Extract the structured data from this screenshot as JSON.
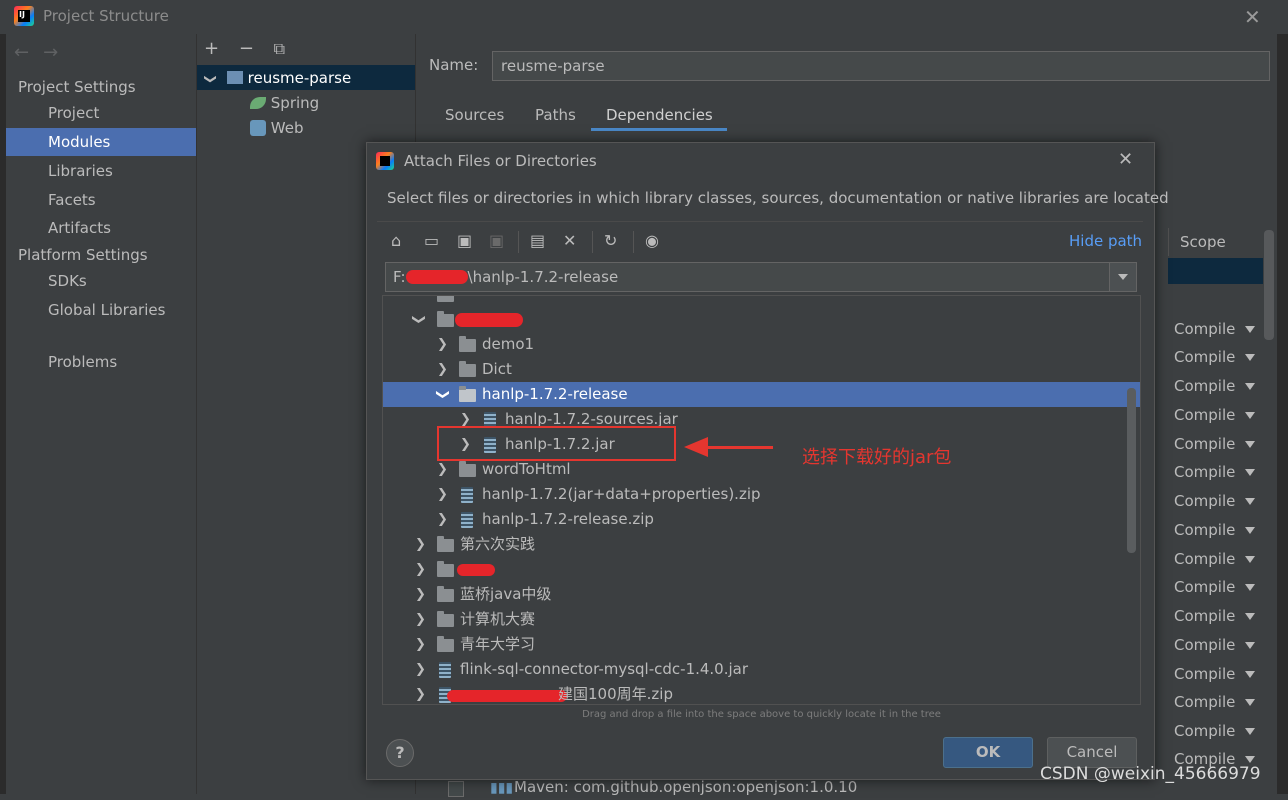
{
  "window": {
    "title": "Project Structure",
    "close": "✕"
  },
  "nav": {
    "back": "←",
    "forward": "→"
  },
  "sidebar": {
    "project_settings": "Project Settings",
    "items_ps": [
      "Project",
      "Modules",
      "Libraries",
      "Facets",
      "Artifacts"
    ],
    "platform_settings": "Platform Settings",
    "items_plat": [
      "SDKs",
      "Global Libraries"
    ],
    "problems": "Problems",
    "selected": "Modules"
  },
  "module_toolbar": {
    "add": "+",
    "remove": "−",
    "copy": "⧉"
  },
  "module_tree": {
    "root": "reusme-parse",
    "children": [
      "Spring",
      "Web"
    ]
  },
  "module_panel": {
    "name_label": "Name:",
    "name_value": "reusme-parse",
    "tabs": [
      "Sources",
      "Paths",
      "Dependencies"
    ],
    "active_tab": "Dependencies",
    "scope_header": "Scope",
    "scope_value": "Compile",
    "maven_row": "Maven: com.github.openjson:openjson:1.0.10"
  },
  "dialog": {
    "title": "Attach Files or Directories",
    "close": "✕",
    "description": "Select files or directories in which library classes, sources, documentation or native libraries are located",
    "hide_path": "Hide path",
    "path_prefix": "F:",
    "path_suffix": "\\hanlp-1.7.2-release",
    "tree": {
      "demo1": "demo1",
      "dict": "Dict",
      "release": "hanlp-1.7.2-release",
      "sources_jar": "hanlp-1.7.2-sources.jar",
      "main_jar": "hanlp-1.7.2.jar",
      "word_to_html": "wordToHtml",
      "zip_props": "hanlp-1.7.2(jar+data+properties).zip",
      "zip_release": "hanlp-1.7.2-release.zip",
      "practice6": "第六次实践",
      "lanqiao": "蓝桥java中级",
      "computer": "计算机大赛",
      "youth": "青年大学习",
      "flink_jar": "flink-sql-connector-mysql-cdc-1.4.0.jar",
      "zip_100": "建国100周年.zip"
    },
    "hint": "Drag and drop a file into the space above to quickly locate it in the tree",
    "help": "?",
    "ok": "OK",
    "cancel": "Cancel"
  },
  "annotation": {
    "text": "选择下载好的jar包",
    "color": "#e5362f"
  },
  "watermark": "CSDN @weixin_45666979",
  "colors": {
    "selection": "#4b6eaf",
    "link": "#589df6",
    "ok_button": "#365880"
  }
}
